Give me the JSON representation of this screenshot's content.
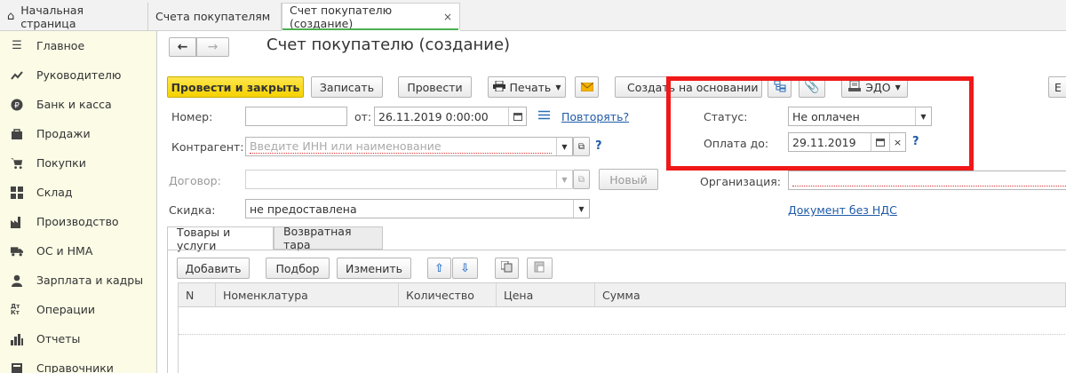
{
  "tabs": {
    "home": "Начальная страница",
    "invoices": "Счета покупателям",
    "current": "Счет покупателю (создание)",
    "close": "×"
  },
  "sidebar": {
    "items": [
      {
        "label": "Главное",
        "icon": "menu-icon"
      },
      {
        "label": "Руководителю",
        "icon": "trend-icon"
      },
      {
        "label": "Банк и касса",
        "icon": "ruble-icon"
      },
      {
        "label": "Продажи",
        "icon": "bag-icon"
      },
      {
        "label": "Покупки",
        "icon": "cart-icon"
      },
      {
        "label": "Склад",
        "icon": "grid-icon"
      },
      {
        "label": "Производство",
        "icon": "factory-icon"
      },
      {
        "label": "ОС и НМА",
        "icon": "truck-icon"
      },
      {
        "label": "Зарплата и кадры",
        "icon": "person-icon"
      },
      {
        "label": "Операции",
        "icon": "dt-kt-icon"
      },
      {
        "label": "Отчеты",
        "icon": "bar-chart-icon"
      },
      {
        "label": "Справочники",
        "icon": "book-icon"
      }
    ],
    "dtkt": "Дт Кт"
  },
  "nav": {
    "back": "🡐",
    "forward": "🡒"
  },
  "form_title": "Счет покупателю (создание)",
  "toolbar": {
    "post_close": "Провести и закрыть",
    "save": "Записать",
    "post": "Провести",
    "print": "Печать",
    "create_based": "Создать на основании",
    "edo": "ЭДО",
    "more": "Е"
  },
  "fields": {
    "number_label": "Номер:",
    "number_value": "",
    "from_label": "от:",
    "date_value": "26.11.2019  0:00:00",
    "repeat_link": "Повторять?",
    "counterparty_label": "Контрагент:",
    "counterparty_placeholder": "Введите ИНН или наименование",
    "contract_label": "Договор:",
    "new_button": "Новый",
    "discount_label": "Скидка:",
    "discount_value": "не предоставлена",
    "status_label": "Статус:",
    "status_value": "Не оплачен",
    "pay_until_label": "Оплата до:",
    "pay_until_value": "29.11.2019",
    "organization_label": "Организация:",
    "vat_link": "Документ без НДС",
    "help": "?"
  },
  "tabs2": {
    "goods": "Товары и услуги",
    "tare": "Возвратная тара"
  },
  "table_toolbar": {
    "add": "Добавить",
    "select": "Подбор",
    "change": "Изменить"
  },
  "table": {
    "columns": [
      "N",
      "Номенклатура",
      "Количество",
      "Цена",
      "Сумма"
    ]
  },
  "colors": {
    "highlight": "#f01818",
    "primary_button": "#f5d200",
    "link": "#1f5aa8"
  }
}
